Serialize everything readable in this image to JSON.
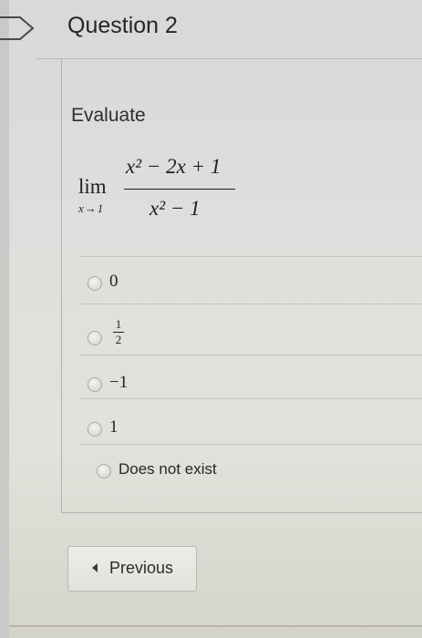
{
  "question": {
    "title": "Question 2",
    "prompt": "Evaluate",
    "formula": {
      "operator": "lim",
      "subscript": "x→1",
      "numerator": "x² − 2x + 1",
      "denominator": "x² − 1"
    }
  },
  "options": [
    {
      "label": "0"
    },
    {
      "numerator": "1",
      "denominator": "2"
    },
    {
      "label": "−1"
    },
    {
      "label": "1"
    },
    {
      "label": "Does not exist"
    }
  ],
  "navigation": {
    "previous_label": "Previous"
  },
  "colors": {
    "background": "#dedfdc",
    "text": "#2c2c2c",
    "divider": "#c3c3bf"
  }
}
